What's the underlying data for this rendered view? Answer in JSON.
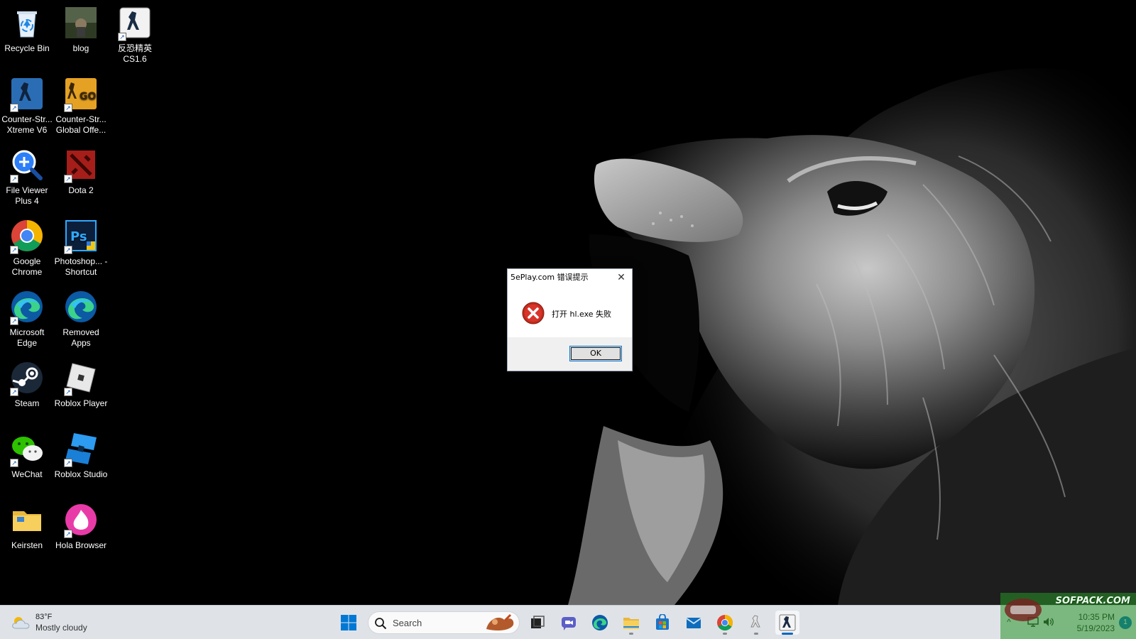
{
  "desktop": {
    "icons": [
      {
        "label": "Recycle Bin",
        "icon": "recycle-bin-icon"
      },
      {
        "label": "blog",
        "icon": "folder-photo-icon"
      },
      {
        "label": "反恐精英 CS1.6",
        "icon": "cs16-icon"
      },
      {
        "label": "Counter-Str... Xtreme V6",
        "icon": "cs-xtreme-icon"
      },
      {
        "label": "Counter-Str... Global Offe...",
        "icon": "csgo-icon"
      },
      {
        "label": "File Viewer Plus 4",
        "icon": "file-viewer-icon"
      },
      {
        "label": "Dota 2",
        "icon": "dota2-icon"
      },
      {
        "label": "Google Chrome",
        "icon": "chrome-icon"
      },
      {
        "label": "Photoshop... - Shortcut",
        "icon": "photoshop-icon"
      },
      {
        "label": "Microsoft Edge",
        "icon": "edge-icon"
      },
      {
        "label": "Removed Apps",
        "icon": "edge-icon"
      },
      {
        "label": "Steam",
        "icon": "steam-icon"
      },
      {
        "label": "Roblox Player",
        "icon": "roblox-player-icon"
      },
      {
        "label": "WeChat",
        "icon": "wechat-icon"
      },
      {
        "label": "Roblox Studio",
        "icon": "roblox-studio-icon"
      },
      {
        "label": "Keirsten",
        "icon": "folder-icon"
      },
      {
        "label": "Hola Browser",
        "icon": "hola-icon"
      }
    ]
  },
  "dialog": {
    "title": "5ePlay.com 错误提示",
    "message": "打开 hl.exe 失败",
    "ok_label": "OK",
    "close_glyph": "✕"
  },
  "taskbar": {
    "weather": {
      "temp": "83°F",
      "condition": "Mostly cloudy"
    },
    "search_placeholder": "Search",
    "apps": [
      "start",
      "search",
      "task-view",
      "meet",
      "edge",
      "file-explorer",
      "store",
      "mail",
      "chrome",
      "cs-xtreme",
      "cs16"
    ],
    "active_app": "cs16"
  },
  "tray": {
    "time": "10:35 PM",
    "date": "5/19/2023",
    "notification_count": "1",
    "chevron": "^"
  },
  "watermark": {
    "text": "SOFPACK.COM"
  },
  "colors": {
    "taskbar": "#dfe3e8",
    "accent": "#0067c0",
    "error_red": "#c42b1c"
  }
}
